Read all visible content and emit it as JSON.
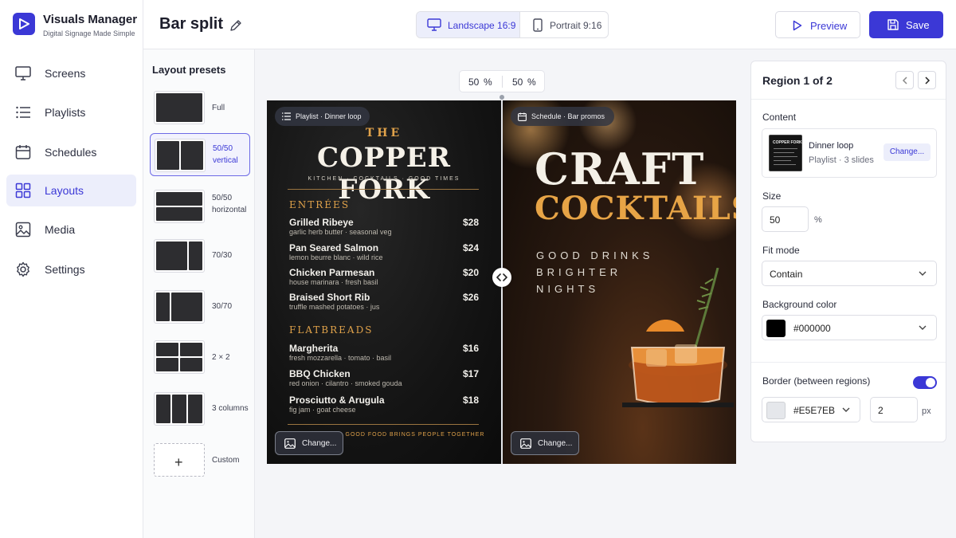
{
  "app": {
    "name": "Visuals Manager",
    "tagline": "Digital Signage Made Simple",
    "brand_color": "#3b38d6"
  },
  "sidebar": {
    "items": [
      {
        "label": "Screens",
        "icon": "monitor-icon",
        "active": false
      },
      {
        "label": "Playlists",
        "icon": "list-icon",
        "active": false
      },
      {
        "label": "Schedules",
        "icon": "calendar-icon",
        "active": false
      },
      {
        "label": "Layouts",
        "icon": "grid-icon",
        "active": true
      },
      {
        "label": "Media",
        "icon": "image-icon",
        "active": false
      },
      {
        "label": "Settings",
        "icon": "gear-icon",
        "active": false
      }
    ]
  },
  "header": {
    "title": "Bar split",
    "orientations": [
      {
        "label": "Landscape 16:9",
        "icon": "landscape-monitor-icon",
        "active": true
      },
      {
        "label": "Portrait 9:16",
        "icon": "portrait-phone-icon",
        "active": false
      }
    ],
    "preview_label": "Preview",
    "save_label": "Save"
  },
  "presets": {
    "title": "Layout presets",
    "items": [
      {
        "label": "Full",
        "active": false
      },
      {
        "label": "50/50 vertical",
        "active": true
      },
      {
        "label": "50/50 horizontal",
        "active": false
      },
      {
        "label": "70/30",
        "active": false
      },
      {
        "label": "30/70",
        "active": false
      },
      {
        "label": "2 × 2",
        "active": false
      },
      {
        "label": "3 columns",
        "active": false
      },
      {
        "label": "Custom",
        "active": false
      }
    ]
  },
  "split": {
    "left_value": "50",
    "right_value": "50",
    "unit": "%"
  },
  "canvas": {
    "left": {
      "chip": "Playlist · Dinner loop",
      "change_label": "Change...",
      "menu": {
        "the": "THE",
        "name": "COPPER FORK",
        "tagline": "KITCHEN · COCKTAILS · GOOD TIMES",
        "sections": [
          {
            "title": "ENTRÉES",
            "items": [
              {
                "name": "Grilled Ribeye",
                "desc": "garlic herb butter · seasonal veg",
                "price": "$28"
              },
              {
                "name": "Pan Seared Salmon",
                "desc": "lemon beurre blanc · wild rice",
                "price": "$24"
              },
              {
                "name": "Chicken Parmesan",
                "desc": "house marinara · fresh basil",
                "price": "$20"
              },
              {
                "name": "Braised Short Rib",
                "desc": "truffle mashed potatoes · jus",
                "price": "$26"
              }
            ]
          },
          {
            "title": "FLATBREADS",
            "items": [
              {
                "name": "Margherita",
                "desc": "fresh mozzarella · tomato · basil",
                "price": "$16"
              },
              {
                "name": "BBQ Chicken",
                "desc": "red onion · cilantro · smoked gouda",
                "price": "$17"
              },
              {
                "name": "Prosciutto & Arugula",
                "desc": "fig jam · goat cheese",
                "price": "$18"
              }
            ]
          }
        ],
        "footer": "GOOD FOOD BRINGS PEOPLE TOGETHER"
      }
    },
    "right": {
      "chip": "Schedule · Bar promos",
      "change_label": "Change...",
      "promo": {
        "line1": "CRAFT",
        "line2": "COCKTAILS",
        "tag_lines": [
          "GOOD DRINKS",
          "BRIGHTER",
          "NIGHTS"
        ]
      }
    }
  },
  "properties": {
    "title": "Region 1 of 2",
    "content_label": "Content",
    "content": {
      "name": "Dinner loop",
      "type": "Playlist",
      "count": "3 slides",
      "change_label": "Change...",
      "thumb_text": "COPPER FORK"
    },
    "size_label": "Size",
    "size_value": "50",
    "size_unit": "%",
    "fit_label": "Fit mode",
    "fit_value": "Contain",
    "bg_label": "Background color",
    "bg_value": "#000000",
    "border_label": "Border (between regions)",
    "border_enabled": true,
    "border_color": "#E5E7EB",
    "border_width": "2",
    "border_unit": "px"
  }
}
